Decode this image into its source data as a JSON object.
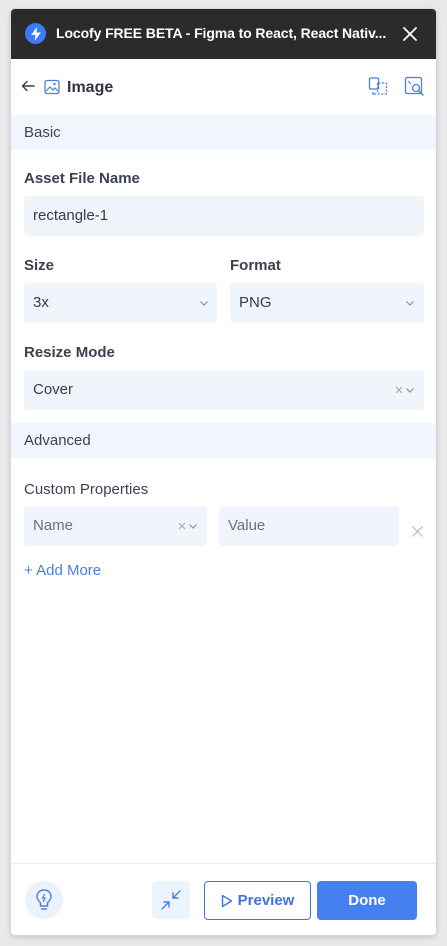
{
  "titlebar": {
    "title": "Locofy FREE BETA - Figma to React, React Nativ...",
    "logo_icon": "lightning-bolt-icon",
    "close_icon": "close-icon"
  },
  "header": {
    "title": "Image",
    "back_icon": "arrow-left-icon",
    "image_icon": "image-icon"
  },
  "sections": {
    "basic": "Basic",
    "advanced": "Advanced"
  },
  "fields": {
    "asset_file_name": {
      "label": "Asset File Name",
      "value": "rectangle-1"
    },
    "size": {
      "label": "Size",
      "value": "3x"
    },
    "format": {
      "label": "Format",
      "value": "PNG"
    },
    "resize_mode": {
      "label": "Resize Mode",
      "value": "Cover"
    },
    "custom_properties": {
      "label": "Custom Properties",
      "name_placeholder": "Name",
      "value_placeholder": "Value",
      "add_more": "+ Add More"
    }
  },
  "footer": {
    "preview_label": "Preview",
    "done_label": "Done"
  },
  "colors": {
    "accent": "#4580f0",
    "titlebar": "#2b2b2b",
    "section_bg": "#f1f6fc",
    "input_bg": "#f0f4fb"
  }
}
